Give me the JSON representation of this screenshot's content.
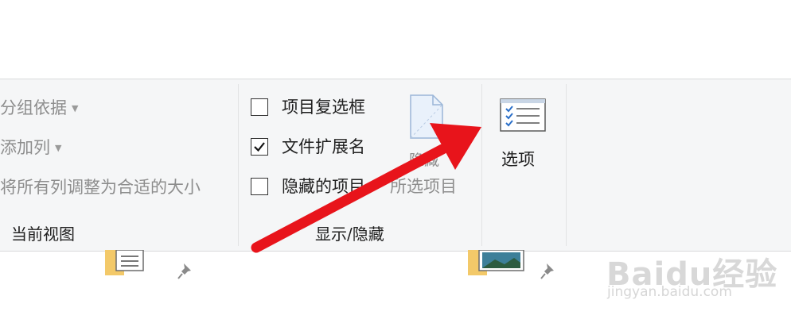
{
  "ribbon": {
    "current_view": {
      "group_by": "分组依据",
      "add_column": "添加列",
      "fit_columns": "将所有列调整为合适的大小",
      "label": "当前视图"
    },
    "show_hide": {
      "item_checkbox": {
        "label": "项目复选框",
        "checked": false
      },
      "file_extension": {
        "label": "文件扩展名",
        "checked": true
      },
      "hidden_items": {
        "label": "隐藏的项目",
        "checked": false
      },
      "hide_button": "隐藏",
      "hide_selected": "所选项目",
      "label": "显示/隐藏"
    },
    "options": {
      "label": "选项"
    }
  },
  "annotation": {
    "arrow_color": "#e8141b"
  },
  "watermark": {
    "main": "Baidu经验",
    "sub": "jingyan.baidu.com"
  },
  "colors": {
    "ribbon_bg": "#f5f6f7",
    "text": "#1e1e1e",
    "disabled_text": "#8d8d8d",
    "accent": "#2a6fc9"
  }
}
